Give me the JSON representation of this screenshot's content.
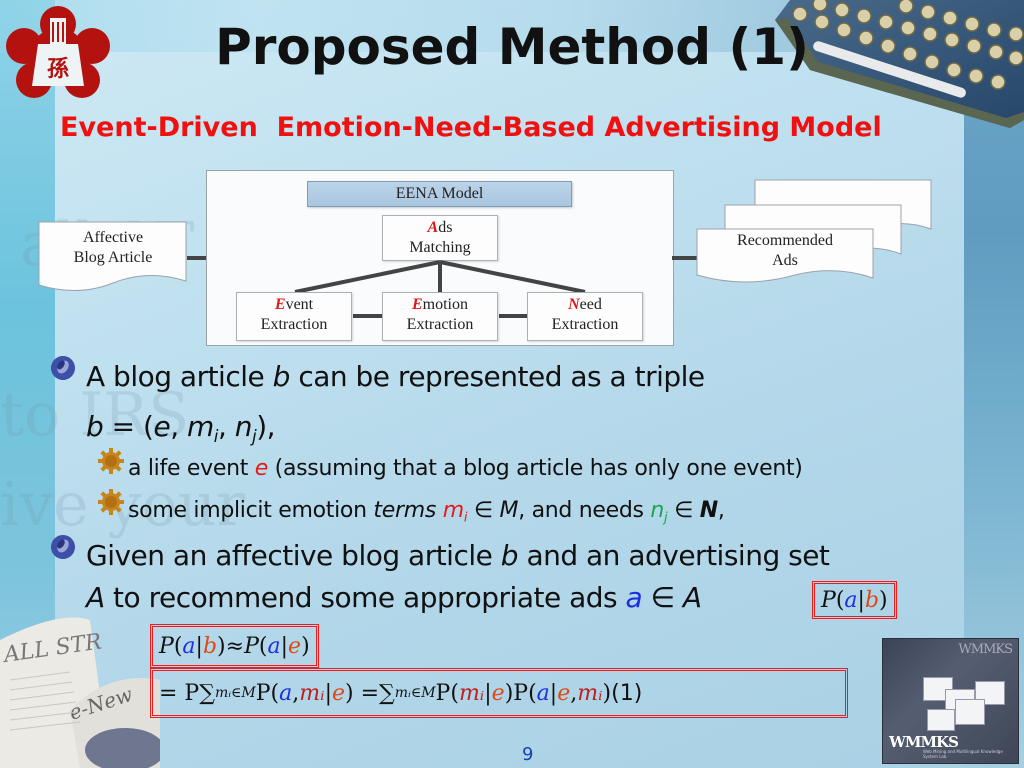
{
  "slide": {
    "title": "Proposed Method (1)",
    "subtitle": "Event-Driven  Emotion-Need-Based Advertising Model",
    "page_number": "9"
  },
  "diagram": {
    "model_label": "EENA Model",
    "input_doc": {
      "line1": "Affective",
      "line2": "Blog Article"
    },
    "output_doc": {
      "line1": "Recommended",
      "line2": "Ads"
    },
    "ads_matching": {
      "initial": "A",
      "rest": "ds",
      "line2": "Matching"
    },
    "event_extraction": {
      "initial": "E",
      "rest": "vent",
      "line2": "Extraction"
    },
    "emotion_extraction": {
      "initial": "E",
      "rest": "motion",
      "line2": "Extraction"
    },
    "need_extraction": {
      "initial": "N",
      "rest": "eed",
      "line2": "Extraction"
    }
  },
  "bullets": {
    "b1": {
      "prefix": "A blog article ",
      "var_b": "b",
      "suffix": " can be represented as a triple",
      "triple": {
        "lhs": "b",
        "eq": " = (",
        "e": "e",
        "comma1": ", ",
        "m": "m",
        "i": "i",
        "comma2": ", ",
        "n": "n",
        "j": "j",
        "close": "),",
        "comma": ""
      }
    },
    "sub1": {
      "prefix": "a life event ",
      "e": "e",
      "suffix": " (assuming that a blog article has only one event)"
    },
    "sub2": {
      "prefix": "some implicit emotion ",
      "terms": "terms",
      "m": "m",
      "i": "i",
      "in1": " ∈ ",
      "M": "M",
      "mid": ", and needs ",
      "n": "n",
      "j": "j",
      "in2": " ∈ ",
      "N": "N",
      "end": ","
    },
    "b2": {
      "line1_prefix": "Given an affective blog article ",
      "b": "b",
      "line1_suffix": " and an advertising set",
      "line2_A": "A",
      "line2_mid": " to recommend some appropriate ads ",
      "a": "a",
      "in": " ∈ ",
      "A": "A"
    }
  },
  "formulas": {
    "target": {
      "P": "P",
      "open": "(",
      "a": "a",
      "bar": "|",
      "b": "b",
      "close": ")"
    },
    "approx": {
      "P1": "P",
      "o1": "(",
      "a1": "a",
      "bar1": "|",
      "b": "b",
      "c1": ")",
      "approx": " ≈ ",
      "P2": "P",
      "o2": "(",
      "a2": "a",
      "bar2": "|",
      "e": "e",
      "c2": ")"
    },
    "expansion": {
      "eq1": "= P ",
      "sum1": "∑",
      "sub1": "mᵢ∈M",
      "t1": " P(",
      "a": "a",
      "comma": ", ",
      "m1": "mᵢ",
      "bar1": "|",
      "e1": "e",
      "t2": ") = ",
      "sum2": "∑",
      "sub2": "mᵢ∈M",
      "t3": " P(",
      "m2": "mᵢ",
      "bar2": "|",
      "e2": "e",
      "t4": ")P(",
      "a2": "a",
      "bar3": "|",
      "e3": "e",
      "comma2": ", ",
      "m3": "mᵢ",
      "t5": ")",
      "eq_num": "(1)"
    }
  },
  "images": {
    "logo": "university-plum-blossom-logo",
    "typewriter": "typewriter-photo",
    "newspaper": "rolled-newspaper-photo",
    "wmmks": {
      "top_label": "WMMKS",
      "bottom_label": "WMMKS",
      "caption": "Web Mining and Multilingual Knowledge System Lab"
    }
  },
  "colors": {
    "title": "#111111",
    "subtitle": "#f01010",
    "highlight_red": "#e41b1b",
    "highlight_green": "#1aa64a",
    "highlight_blue": "#1a2fe0",
    "formula_border": "#ee1c1c",
    "page_number": "#1a3fb8"
  }
}
